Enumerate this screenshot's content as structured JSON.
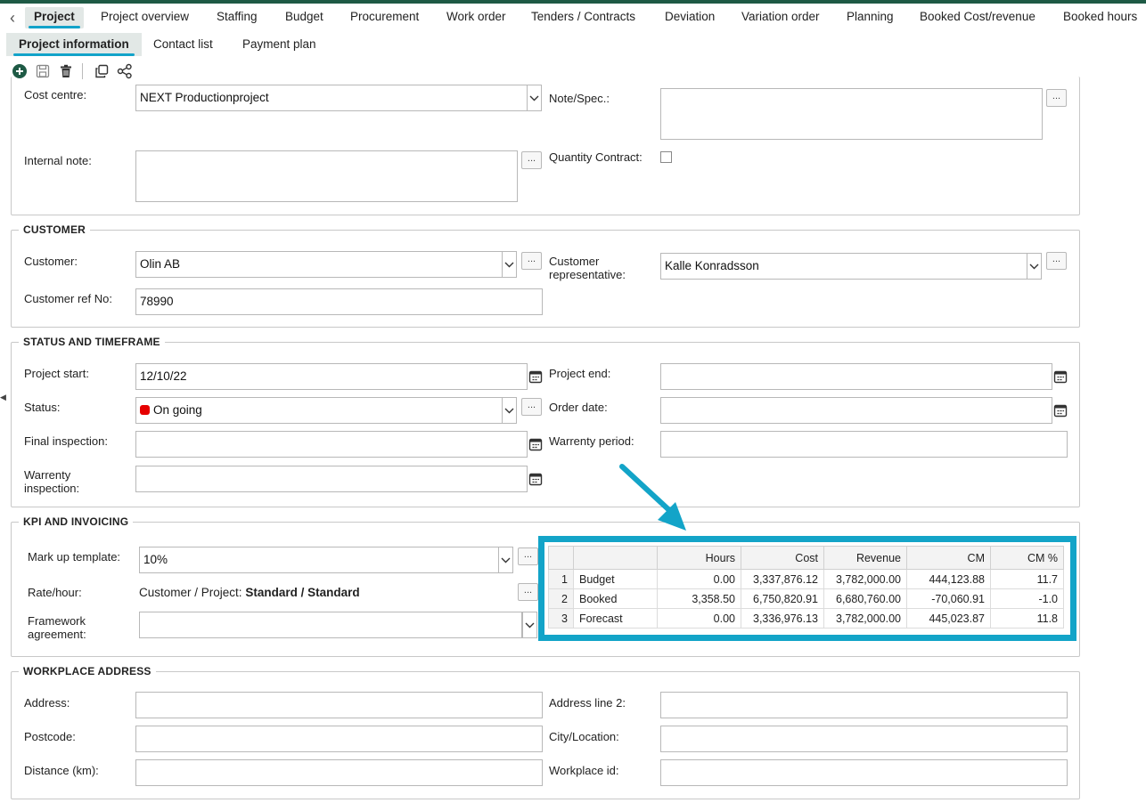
{
  "tabs_main": [
    "Project",
    "Project overview",
    "Staffing",
    "Budget",
    "Procurement",
    "Work order",
    "Tenders / Contracts",
    "Deviation",
    "Variation order",
    "Planning",
    "Booked Cost/revenue",
    "Booked hours"
  ],
  "tabs_sub": [
    "Project information",
    "Contact list",
    "Payment plan"
  ],
  "general": {
    "cost_centre_label": "Cost centre:",
    "cost_centre_value": "NEXT Productionproject",
    "note_spec_label": "Note/Spec.:",
    "internal_note_label": "Internal note:",
    "quantity_contract_label": "Quantity Contract:"
  },
  "customer": {
    "title": "CUSTOMER",
    "customer_label": "Customer:",
    "customer_value": "Olin AB",
    "customer_rep_label_1": "Customer",
    "customer_rep_label_2": "representative:",
    "customer_rep_value": "Kalle Konradsson",
    "ref_label": "Customer ref No:",
    "ref_value": "78990"
  },
  "status": {
    "title": "STATUS AND TIMEFRAME",
    "start_label": "Project start:",
    "start_value": "12/10/22",
    "end_label": "Project end:",
    "status_label": "Status:",
    "status_value": "On going",
    "order_date_label": "Order date:",
    "final_inspection_label": "Final inspection:",
    "warrenty_period_label": "Warrenty period:",
    "warrenty_inspection_label_1": "Warrenty",
    "warrenty_inspection_label_2": "inspection:",
    "status_color": "#e60000"
  },
  "kpi": {
    "title": "KPI AND INVOICING",
    "markup_label": "Mark up template:",
    "markup_value": "10%",
    "rate_label": "Rate/hour:",
    "rate_prefix": "Customer / Project:",
    "rate_value": "Standard / Standard",
    "framework_label_1": "Framework",
    "framework_label_2": "agreement:",
    "table": {
      "headers": [
        "",
        "",
        "Hours",
        "Cost",
        "Revenue",
        "CM",
        "CM %"
      ],
      "rows": [
        [
          "1",
          "Budget",
          "0.00",
          "3,337,876.12",
          "3,782,000.00",
          "444,123.88",
          "11.7"
        ],
        [
          "2",
          "Booked",
          "3,358.50",
          "6,750,820.91",
          "6,680,760.00",
          "-70,060.91",
          "-1.0"
        ],
        [
          "3",
          "Forecast",
          "0.00",
          "3,336,976.13",
          "3,782,000.00",
          "445,023.87",
          "11.8"
        ]
      ]
    },
    "highlight_color": "#13a4c8"
  },
  "workplace": {
    "title": "WORKPLACE ADDRESS",
    "address_label": "Address:",
    "address2_label": "Address line 2:",
    "postcode_label": "Postcode:",
    "city_label": "City/Location:",
    "distance_label": "Distance (km):",
    "workplace_id_label": "Workplace id:"
  }
}
